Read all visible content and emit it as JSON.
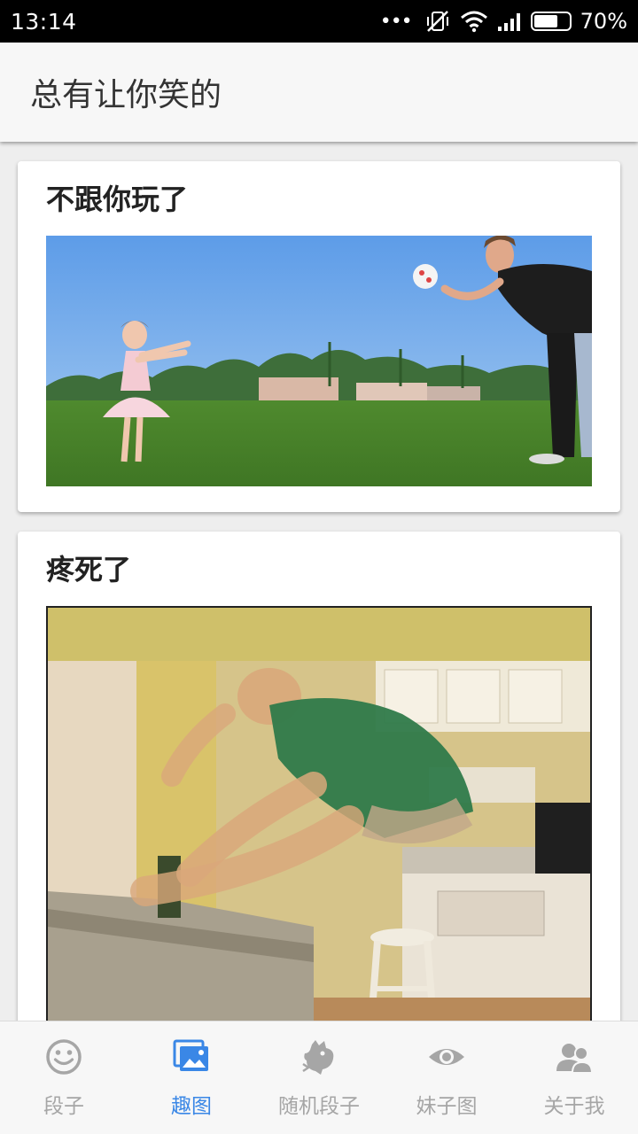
{
  "status_bar": {
    "time": "13:14",
    "more": "•••",
    "battery": "70%",
    "battery_level": 0.7
  },
  "app_bar": {
    "title": "总有让你笑的"
  },
  "feed": {
    "cards": [
      {
        "title": "不跟你玩了"
      },
      {
        "title": "疼死了"
      }
    ]
  },
  "bottom_nav": {
    "items": [
      {
        "label": "段子",
        "icon": "smiley-face-icon",
        "active": false
      },
      {
        "label": "趣图",
        "icon": "picture-gallery-icon",
        "active": true
      },
      {
        "label": "随机段子",
        "icon": "dragon-icon",
        "active": false
      },
      {
        "label": "妹子图",
        "icon": "eye-icon",
        "active": false
      },
      {
        "label": "关于我",
        "icon": "people-icon",
        "active": false
      }
    ],
    "active_color": "#3a87e6",
    "inactive_color": "#a6a6a6"
  }
}
